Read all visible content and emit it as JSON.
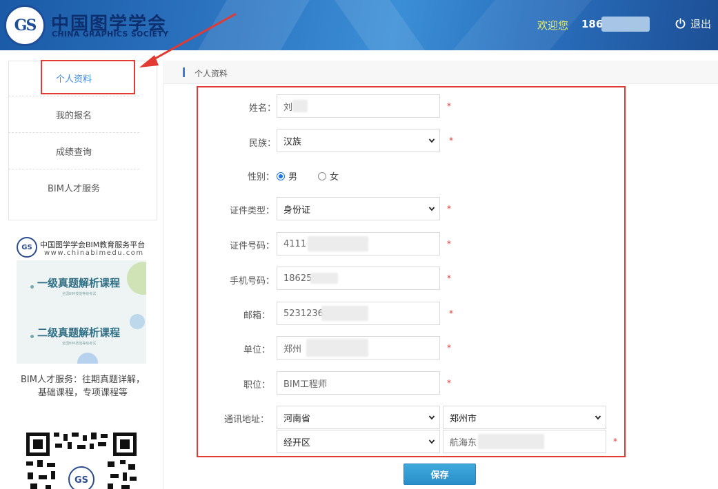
{
  "header": {
    "logo_mark": "GS",
    "logo_cn": "中国图学学会",
    "logo_en": "CHINA GRAPHICS SOCIETY",
    "welcome": "欢迎您",
    "user_prefix": "186",
    "logout_label": "退出"
  },
  "sidebar": {
    "items": [
      {
        "label": "个人资料",
        "active": true
      },
      {
        "label": "我的报名",
        "active": false
      },
      {
        "label": "成绩查询",
        "active": false
      },
      {
        "label": "BIM人才服务",
        "active": false
      }
    ],
    "promo": {
      "title": "中国图学学会BIM教育服务平台",
      "url": "www.chinabimedu.com",
      "course1": "一级真题解析课程",
      "course2": "二级真题解析课程",
      "course_sub": "全国BIM技能等级考试",
      "text_line1": "BIM人才服务：往期真题详解，",
      "text_line2": "基础课程，专项课程等"
    }
  },
  "main": {
    "section_title": "个人资料",
    "form": {
      "name": {
        "label": "姓名：",
        "value": "刘",
        "required": "*"
      },
      "ethnicity": {
        "label": "民族：",
        "value": "汉族",
        "required": "*"
      },
      "gender": {
        "label": "性别：",
        "options": [
          "男",
          "女"
        ],
        "selected": "男"
      },
      "id_type": {
        "label": "证件类型：",
        "value": "身份证",
        "required": "*"
      },
      "id_number": {
        "label": "证件号码：",
        "value": "4111",
        "required": "*"
      },
      "phone": {
        "label": "手机号码：",
        "value": "18625",
        "required": "*"
      },
      "email": {
        "label": "邮箱：",
        "value": "5231236",
        "required": "*"
      },
      "company": {
        "label": "单位：",
        "value": "郑州",
        "required": "*"
      },
      "position": {
        "label": "职位：",
        "value": "BIM工程师",
        "required": "*"
      },
      "address": {
        "label": "通讯地址：",
        "province": "河南省",
        "city": "郑州市",
        "district": "经开区",
        "street": "航海东",
        "required": "*"
      }
    },
    "save_label": "保存"
  },
  "colors": {
    "accent": "#3a8ee6",
    "annotation_red": "#e23a32",
    "header_blue": "#2f78c4",
    "button_blue": "#2a8fc8"
  }
}
